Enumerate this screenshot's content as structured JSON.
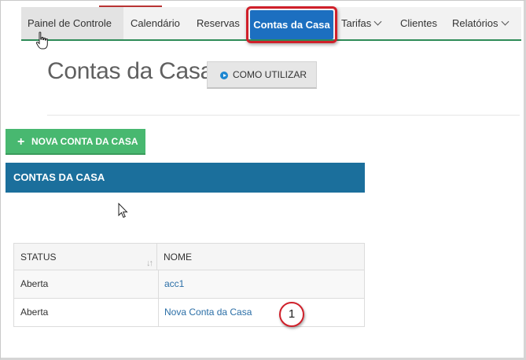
{
  "nav": {
    "items": [
      {
        "label": "Painel de Controle",
        "dropdown": false
      },
      {
        "label": "Calendário",
        "dropdown": false
      },
      {
        "label": "Reservas",
        "dropdown": false
      },
      {
        "label": "Contas da Casa",
        "dropdown": false,
        "active": true
      },
      {
        "label": "Tarifas",
        "dropdown": true
      },
      {
        "label": "Clientes",
        "dropdown": false
      },
      {
        "label": "Relatórios",
        "dropdown": true
      }
    ]
  },
  "header": {
    "title": "Contas da Casa",
    "how_to_label": "COMO UTILIZAR"
  },
  "actions": {
    "new_account_label": "NOVA CONTA DA CASA"
  },
  "panel": {
    "title": "CONTAS DA CASA"
  },
  "table": {
    "columns": [
      "STATUS",
      "NOME"
    ],
    "rows": [
      {
        "status": "Aberta",
        "nome": "acc1"
      },
      {
        "status": "Aberta",
        "nome": "Nova Conta da Casa"
      }
    ]
  },
  "annotation": {
    "step_number": "1"
  },
  "colors": {
    "nav_active": "#1c6fc0",
    "highlight_border": "#d0202a",
    "nav_underline": "#2e8b57",
    "new_button": "#48b870",
    "panel_header": "#1b6f9c",
    "link": "#2a6ea6"
  }
}
